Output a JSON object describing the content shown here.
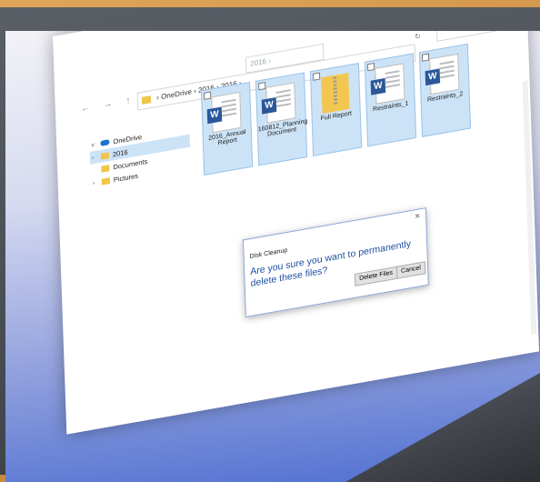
{
  "window": {
    "minimize": "–",
    "maximize": "☐",
    "close": "✕"
  },
  "address_bar": {
    "path": "› OneDrive › 2016 › 2016 ›",
    "second_box": "2016 ›",
    "search_icon": "🔍",
    "refresh_icon": "↻"
  },
  "nav": {
    "arrows": "← → ↑"
  },
  "sidebar": {
    "items": [
      {
        "label": "OneDrive",
        "icon": "cloud-icon"
      },
      {
        "label": "2016",
        "icon": "folder-icon"
      },
      {
        "label": "Documents",
        "icon": "folder-icon"
      },
      {
        "label": "Pictures",
        "icon": "folder-icon"
      }
    ]
  },
  "files": [
    {
      "name": "2016_Annual Report",
      "type": "word"
    },
    {
      "name": "160812_Planning Document",
      "type": "word"
    },
    {
      "name": "Full Report",
      "type": "zip"
    },
    {
      "name": "Restraints_1",
      "type": "word"
    },
    {
      "name": "Restraints_2",
      "type": "word"
    }
  ],
  "dialog": {
    "title": "Disk Cleanup",
    "message": "Are you sure you want to permanently delete these files?",
    "delete_button": "Delete Files",
    "cancel_button": "Cancel",
    "close": "×"
  },
  "colors": {
    "word_blue": "#2b579a",
    "selection": "#cce3f7",
    "folder": "#f0c54a"
  }
}
